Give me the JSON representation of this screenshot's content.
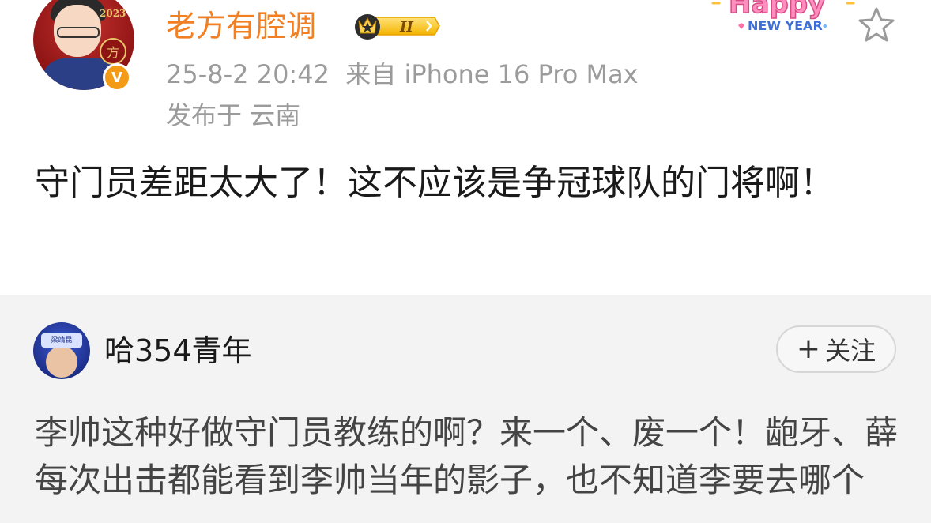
{
  "post": {
    "username": "老方有腔调",
    "vip_level": "II",
    "verify_mark": "V",
    "avatar": {
      "year_text": "2023",
      "badge_text": "方"
    },
    "timestamp": "25-8-2 20:42",
    "source": "来自 iPhone 16 Pro Max",
    "location": "发布于 云南",
    "sticker": {
      "line1": "Happy",
      "line2": "NEW YEAR"
    },
    "text": "守门员差距太大了！这不应该是争冠球队的门将啊！",
    "icons": {
      "favorite": "star-icon",
      "vip": "crown-icon"
    }
  },
  "comment": {
    "username": "哈354青年",
    "avatar_band_text": "梁靖昆",
    "follow_label": "关注",
    "follow_plus": "+",
    "text": "李帅这种好做守门员教练的啊？来一个、废一个！龅牙、薛每次出击都能看到李帅当年的影子，也不知道李要去哪个"
  },
  "colors": {
    "username": "#f27f21",
    "meta": "#9b9b9b",
    "verify": "#f39a16",
    "comment_bg": "#f3f3f3"
  }
}
